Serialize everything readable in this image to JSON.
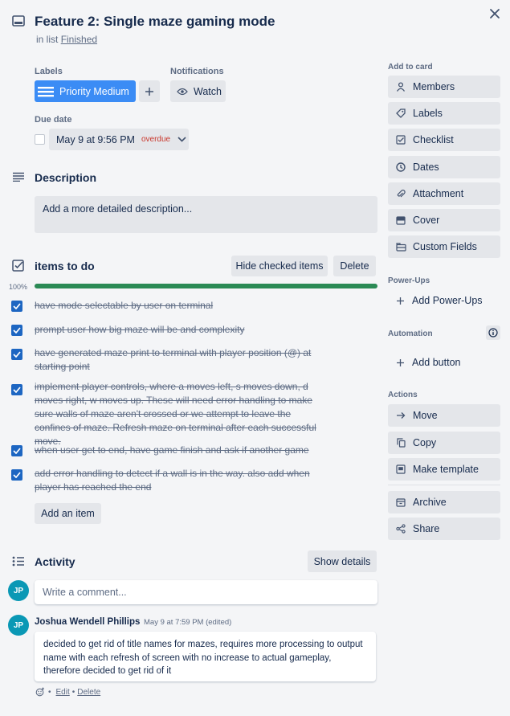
{
  "card": {
    "title": "Feature 2: Single maze gaming mode",
    "in_list_prefix": "in list",
    "list_name": "Finished"
  },
  "labels": {
    "heading": "Labels",
    "chip": "Priority Medium",
    "chip_color": "#3b8cf5"
  },
  "notifications": {
    "heading": "Notifications",
    "watch": "Watch"
  },
  "due": {
    "heading": "Due date",
    "date": "May 9 at 9:56 PM",
    "status": "overdue",
    "status_color": "#c9372c"
  },
  "description": {
    "heading": "Description",
    "placeholder": "Add a more detailed description..."
  },
  "checklist": {
    "title": "items to do",
    "hide_btn": "Hide checked items",
    "delete_btn": "Delete",
    "progress_pct": "100%",
    "progress": 1.0,
    "progress_color": "#2b8a55",
    "items": [
      "have mode selectable by user on terminal",
      "prompt user how big maze will be and complexity",
      "have generated maze print to terminal with player position (@) at starting point",
      "implement player controls, where a moves left, s moves down, d moves right, w moves up. These will need error handling to make sure walls of maze aren't crossed or we attempt to leave the confines of maze. Refresh maze on terminal after each successful move.",
      "when user get to end, have game finish and ask if another game",
      "add error handling to detect if a wall is in the way. also add when player has reached the end"
    ],
    "add_item": "Add an item"
  },
  "activity": {
    "heading": "Activity",
    "show_details": "Show details",
    "comment_placeholder": "Write a comment...",
    "avatar_initials": "JP",
    "author": "Joshua Wendell Phillips",
    "timestamp": "May 9 at 7:59 PM (edited)",
    "comment": "decided to get rid of title names for mazes, requires more processing to output name with each refresh of screen with no increase to actual gameplay, therefore decided to get rid of it",
    "bullet": "•",
    "edit": "Edit",
    "delete": "Delete"
  },
  "sidebar": {
    "add_to_card": "Add to card",
    "add_items": [
      {
        "label": "Members",
        "icon": "person-icon"
      },
      {
        "label": "Labels",
        "icon": "tag-icon"
      },
      {
        "label": "Checklist",
        "icon": "checklist-icon"
      },
      {
        "label": "Dates",
        "icon": "clock-icon"
      },
      {
        "label": "Attachment",
        "icon": "paperclip-icon"
      },
      {
        "label": "Cover",
        "icon": "cover-icon"
      },
      {
        "label": "Custom Fields",
        "icon": "custom-fields-icon"
      }
    ],
    "powerups_heading": "Power-Ups",
    "add_powerups": "Add Power-Ups",
    "automation_heading": "Automation",
    "add_button": "Add button",
    "actions_heading": "Actions",
    "actions": [
      {
        "label": "Move",
        "icon": "arrow-right-icon"
      },
      {
        "label": "Copy",
        "icon": "copy-icon"
      },
      {
        "label": "Make template",
        "icon": "template-icon"
      }
    ],
    "archive": "Archive",
    "share": "Share"
  }
}
